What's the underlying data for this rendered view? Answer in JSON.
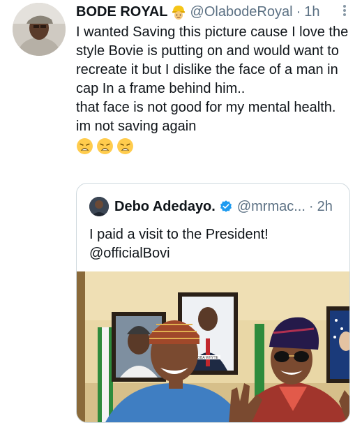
{
  "tweet": {
    "author_name": "BODE ROYAL",
    "author_badge_icon": "construction-worker-emoji",
    "handle": "@OlabodeRoyal",
    "separator": "·",
    "time": "1h",
    "text": "I wanted Saving this picture cause I love the style Bovie is putting on and would want to recreate it but I dislike the face of a man in cap In a frame behind him..\nthat face is not good for my mental health.\nim not saving again",
    "emojis": [
      "weary-face-emoji",
      "weary-face-emoji",
      "weary-face-emoji"
    ]
  },
  "quoted_tweet": {
    "author_name": "Debo Adedayo.",
    "verified": true,
    "handle": "@mrmac...",
    "separator": "·",
    "time": "2h",
    "text": "I paid a visit to the President!\n@officialBovi",
    "photo": {
      "description_icon": "photo",
      "frame_caption": "OBA WHYTE"
    }
  },
  "colors": {
    "text": "#0f1419",
    "secondary": "#5b7083",
    "border": "#cfd9de",
    "verified": "#1d9bf0"
  }
}
